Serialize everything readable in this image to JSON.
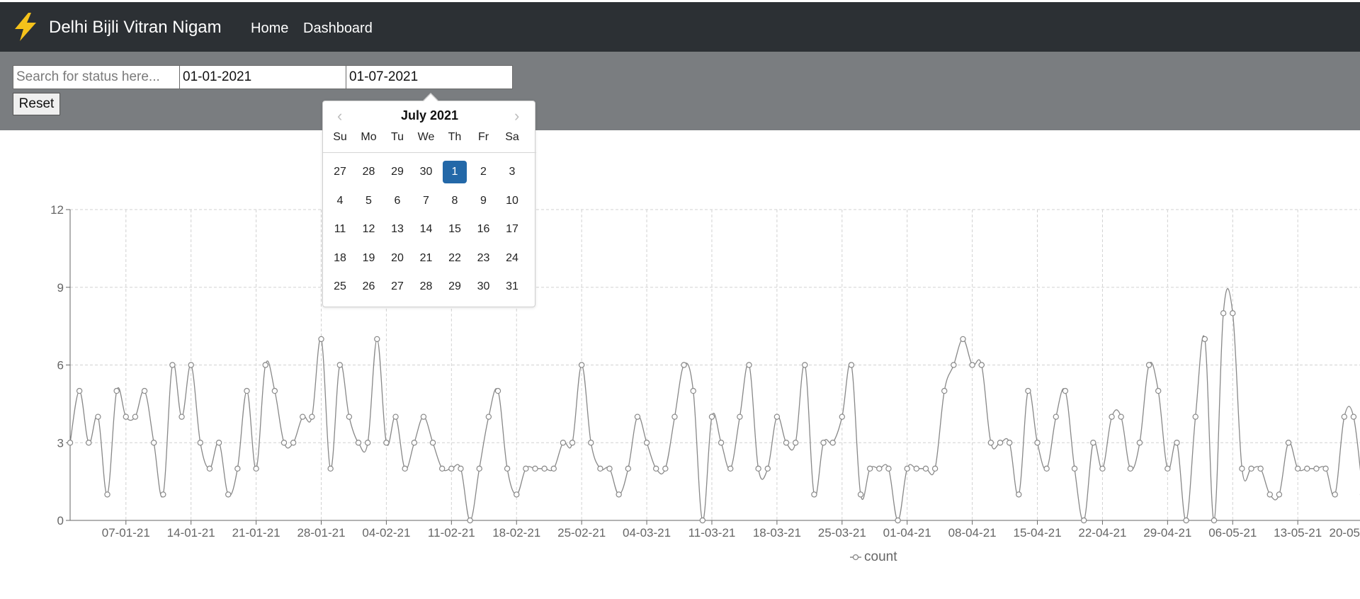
{
  "navbar": {
    "brand": "Delhi Bijli Vitran Nigam",
    "brand_icon": "lightning-bolt-icon",
    "links": [
      "Home",
      "Dashboard"
    ]
  },
  "filters": {
    "search_placeholder": "Search for status here...",
    "search_value": "",
    "start_date": "01-01-2021",
    "end_date": "01-07-2021",
    "reset_label": "Reset"
  },
  "datepicker": {
    "title": "July 2021",
    "prev_icon": "chevron-left-icon",
    "next_icon": "chevron-right-icon",
    "weekdays": [
      "Su",
      "Mo",
      "Tu",
      "We",
      "Th",
      "Fr",
      "Sa"
    ],
    "weeks": [
      [
        "27",
        "28",
        "29",
        "30",
        "1",
        "2",
        "3"
      ],
      [
        "4",
        "5",
        "6",
        "7",
        "8",
        "9",
        "10"
      ],
      [
        "11",
        "12",
        "13",
        "14",
        "15",
        "16",
        "17"
      ],
      [
        "18",
        "19",
        "20",
        "21",
        "22",
        "23",
        "24"
      ],
      [
        "25",
        "26",
        "27",
        "28",
        "29",
        "30",
        "31"
      ]
    ],
    "selected": "1"
  },
  "chart_data": {
    "type": "line",
    "series": [
      {
        "name": "count",
        "values": [
          3,
          5,
          3,
          4,
          1,
          5,
          4,
          4,
          5,
          3,
          1,
          6,
          4,
          6,
          3,
          2,
          3,
          1,
          2,
          5,
          2,
          6,
          5,
          3,
          3,
          4,
          4,
          7,
          2,
          6,
          4,
          3,
          3,
          7,
          3,
          4,
          2,
          3,
          4,
          3,
          2,
          2,
          2,
          0,
          2,
          4,
          5,
          2,
          1,
          2,
          2,
          2,
          2,
          3,
          3,
          6,
          3,
          2,
          2,
          1,
          2,
          4,
          3,
          2,
          2,
          4,
          6,
          5,
          0,
          4,
          3,
          2,
          4,
          6,
          2,
          2,
          4,
          3,
          3,
          6,
          1,
          3,
          3,
          4,
          6,
          1,
          2,
          2,
          2,
          0,
          2,
          2,
          2,
          2,
          5,
          6,
          7,
          6,
          6,
          3,
          3,
          3,
          1,
          5,
          3,
          2,
          4,
          5,
          2,
          0,
          3,
          2,
          4,
          4,
          2,
          3,
          6,
          5,
          2,
          3,
          0,
          4,
          7,
          0,
          8,
          8,
          2,
          2,
          2,
          1,
          1,
          3,
          2,
          2,
          2,
          2,
          1,
          4,
          4,
          1
        ]
      }
    ],
    "x_tick_labels": [
      "07-01-21",
      "14-01-21",
      "21-01-21",
      "28-01-21",
      "04-02-21",
      "11-02-21",
      "18-02-21",
      "25-02-21",
      "04-03-21",
      "11-03-21",
      "18-03-21",
      "25-03-21",
      "01-04-21",
      "08-04-21",
      "15-04-21",
      "22-04-21",
      "29-04-21",
      "06-05-21",
      "13-05-21",
      "20-05"
    ],
    "y_ticks": [
      "0",
      "3",
      "6",
      "9",
      "12"
    ],
    "ylim": [
      0,
      12
    ],
    "grid": true,
    "legend": "bottom-center",
    "color": "#888888"
  }
}
